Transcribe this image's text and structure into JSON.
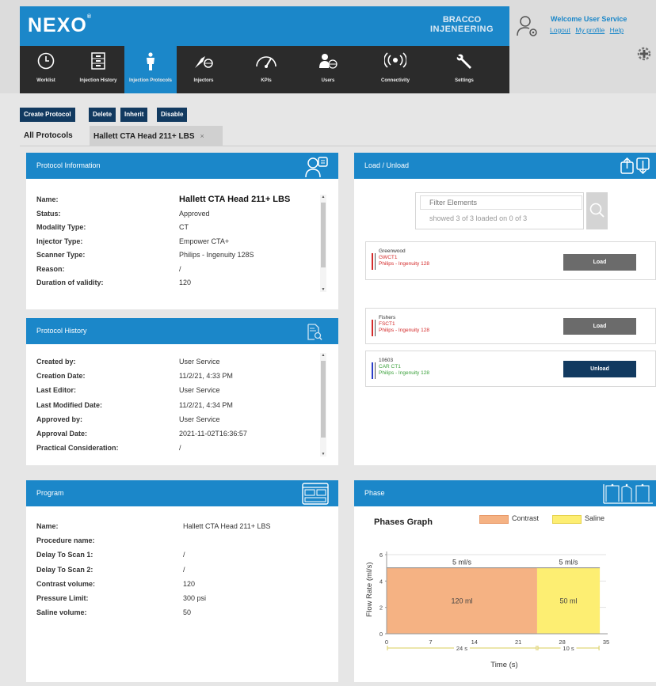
{
  "header": {
    "logo": "NEXO",
    "logo_mark": "®",
    "brand_line1": "BRACCO",
    "brand_line2": "INJENEERING",
    "welcome": "Welcome User Service",
    "links": [
      "Logout",
      "My profile",
      "Help"
    ]
  },
  "nav": [
    {
      "label": "Worklist",
      "icon": "clock-icon"
    },
    {
      "label": "Injection History",
      "icon": "cabinet-icon"
    },
    {
      "label": "Injection Protocols",
      "icon": "person-icon",
      "active": true
    },
    {
      "label": "Injectors",
      "icon": "injector-icon"
    },
    {
      "label": "KPIs",
      "icon": "gauge-icon"
    },
    {
      "label": "Users",
      "icon": "user-globe-icon"
    },
    {
      "label": "Connectivity",
      "icon": "broadcast-icon"
    },
    {
      "label": "Settings",
      "icon": "wrench-icon"
    }
  ],
  "toolbar": {
    "create": "Create Protocol",
    "delete": "Delete",
    "inherit": "Inherit",
    "disable": "Disable"
  },
  "tabs": {
    "all": "All Protocols",
    "current": "Hallett CTA Head 211+ LBS",
    "close": "×"
  },
  "protocol_info": {
    "title": "Protocol Information",
    "rows": [
      {
        "k": "Name:",
        "v": "Hallett CTA Head 211+ LBS"
      },
      {
        "k": "Status:",
        "v": "Approved"
      },
      {
        "k": "Modality Type:",
        "v": "CT"
      },
      {
        "k": "Injector Type:",
        "v": "Empower CTA+"
      },
      {
        "k": "Scanner Type:",
        "v": "Philips - Ingenuity 128S"
      },
      {
        "k": "Reason:",
        "v": "/"
      },
      {
        "k": "Duration of validity:",
        "v": "120"
      }
    ]
  },
  "protocol_history": {
    "title": "Protocol History",
    "rows": [
      {
        "k": "Created by:",
        "v": "User Service"
      },
      {
        "k": "Creation Date:",
        "v": "11/2/21, 4:33 PM"
      },
      {
        "k": "Last Editor:",
        "v": "User Service"
      },
      {
        "k": "Last Modified Date:",
        "v": "11/2/21, 4:34 PM"
      },
      {
        "k": "Approved by:",
        "v": "User Service"
      },
      {
        "k": "Approval Date:",
        "v": "2021-11-02T16:36:57"
      },
      {
        "k": "Practical Consideration:",
        "v": "/"
      }
    ]
  },
  "program": {
    "title": "Program",
    "rows": [
      {
        "k": "Name:",
        "v": "Hallett CTA Head 211+ LBS"
      },
      {
        "k": "Procedure name:",
        "v": ""
      },
      {
        "k": "Delay To Scan 1:",
        "v": "/"
      },
      {
        "k": "Delay To Scan 2:",
        "v": "/"
      },
      {
        "k": "Contrast volume:",
        "v": "120"
      },
      {
        "k": "Pressure Limit:",
        "v": "300 psi"
      },
      {
        "k": "Saline volume:",
        "v": "50"
      }
    ]
  },
  "load_unload": {
    "title": "Load / Unload",
    "filter_placeholder": "Filter Elements",
    "filter_status": "showed 3 of 3 loaded on 0 of 3",
    "cards": [
      {
        "name": "Greenwood",
        "scanner": "GWCT1",
        "model": "Philips - Ingenuity 128",
        "action": "Load",
        "bar_color": "#d42a2a",
        "scanner_color": "#d42a2a",
        "model_color": "#d42a2a",
        "btn_color": "#6b6b6b"
      },
      {
        "name": "Fishers",
        "scanner": "FSCT1",
        "model": "Philips - Ingenuity 128",
        "action": "Load",
        "bar_color": "#d42a2a",
        "scanner_color": "#d42a2a",
        "model_color": "#d42a2a",
        "btn_color": "#6b6b6b"
      },
      {
        "name": "10603",
        "scanner": "CAR CT1",
        "model": "Philips - Ingenuity 128",
        "action": "Unload",
        "bar_color": "#2a3ec9",
        "scanner_color": "#3aa03a",
        "model_color": "#3aa03a",
        "btn_color": "#123a60"
      }
    ]
  },
  "phase": {
    "title": "Phase"
  },
  "chart_data": {
    "type": "bar",
    "title": "Phases Graph",
    "xlabel": "Time (s)",
    "ylabel": "Flow Rate (ml/s)",
    "xlim": [
      0,
      35
    ],
    "ylim": [
      0,
      6
    ],
    "xticks": [
      "0",
      "7",
      "14",
      "21",
      "28",
      "35"
    ],
    "yticks": [
      "0",
      "2",
      "4",
      "6"
    ],
    "series": [
      {
        "name": "Contrast",
        "color": "#f5b283",
        "start": 0,
        "end": 24,
        "rate": 5,
        "rate_label": "5 ml/s",
        "volume_label": "120 ml",
        "duration_label": "24 s"
      },
      {
        "name": "Saline",
        "color": "#fdee72",
        "start": 24,
        "end": 34,
        "rate": 5,
        "rate_label": "5 ml/s",
        "volume_label": "50 ml",
        "duration_label": "10 s"
      }
    ]
  }
}
